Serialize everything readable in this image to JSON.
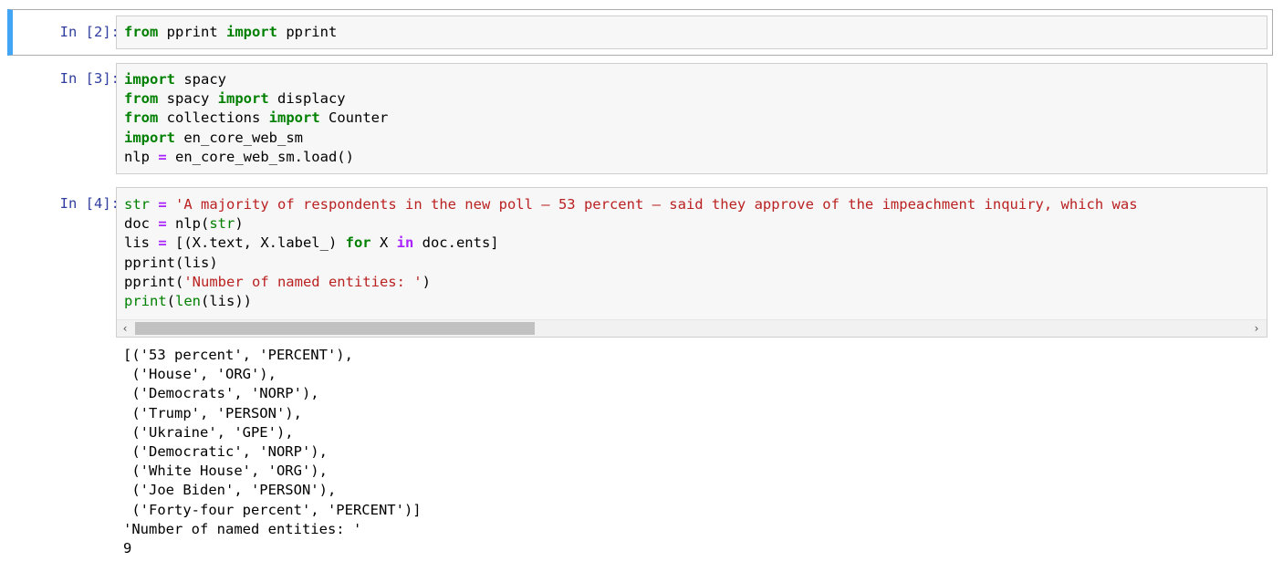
{
  "cells": [
    {
      "prompt": "In [2]:",
      "lines": [
        [
          {
            "t": "from",
            "c": "kw"
          },
          {
            "t": " pprint "
          },
          {
            "t": "import",
            "c": "kw"
          },
          {
            "t": " pprint"
          }
        ]
      ]
    },
    {
      "prompt": "In [3]:",
      "lines": [
        [
          {
            "t": "import",
            "c": "kw"
          },
          {
            "t": " spacy"
          }
        ],
        [
          {
            "t": "from",
            "c": "kw"
          },
          {
            "t": " spacy "
          },
          {
            "t": "import",
            "c": "kw"
          },
          {
            "t": " displacy"
          }
        ],
        [
          {
            "t": "from",
            "c": "kw"
          },
          {
            "t": " collections "
          },
          {
            "t": "import",
            "c": "kw"
          },
          {
            "t": " Counter"
          }
        ],
        [
          {
            "t": "import",
            "c": "kw"
          },
          {
            "t": " en_core_web_sm"
          }
        ],
        [
          {
            "t": "nlp "
          },
          {
            "t": "=",
            "c": "op"
          },
          {
            "t": " en_core_web_sm.load()"
          }
        ]
      ]
    },
    {
      "prompt": "In [4]:",
      "lines": [
        [
          {
            "t": "str",
            "c": "bi"
          },
          {
            "t": " "
          },
          {
            "t": "=",
            "c": "op"
          },
          {
            "t": " "
          },
          {
            "t": "'A majority of respondents in the new poll – 53 percent – said they approve of the impeachment inquiry, which was",
            "c": "str"
          }
        ],
        [
          {
            "t": "doc "
          },
          {
            "t": "=",
            "c": "op"
          },
          {
            "t": " nlp("
          },
          {
            "t": "str",
            "c": "bi"
          },
          {
            "t": ")"
          }
        ],
        [
          {
            "t": "lis "
          },
          {
            "t": "=",
            "c": "op"
          },
          {
            "t": " [(X.text, X.label_) "
          },
          {
            "t": "for",
            "c": "kw"
          },
          {
            "t": " X "
          },
          {
            "t": "in",
            "c": "op"
          },
          {
            "t": " doc.ents]"
          }
        ],
        [
          {
            "t": "pprint(lis)"
          }
        ],
        [
          {
            "t": "pprint("
          },
          {
            "t": "'Number of named entities: '",
            "c": "str"
          },
          {
            "t": ")"
          }
        ],
        [
          {
            "t": "print",
            "c": "bi"
          },
          {
            "t": "("
          },
          {
            "t": "len",
            "c": "bi"
          },
          {
            "t": "(lis))"
          }
        ]
      ],
      "output": [
        "[('53 percent', 'PERCENT'),",
        " ('House', 'ORG'),",
        " ('Democrats', 'NORP'),",
        " ('Trump', 'PERSON'),",
        " ('Ukraine', 'GPE'),",
        " ('Democratic', 'NORP'),",
        " ('White House', 'ORG'),",
        " ('Joe Biden', 'PERSON'),",
        " ('Forty-four percent', 'PERCENT')]",
        "'Number of named entities: '",
        "9"
      ]
    }
  ],
  "scrollbar": {
    "left_arrow": "‹",
    "right_arrow": "›"
  },
  "colors": {
    "keyword": "#008000",
    "operator": "#aa22ff",
    "string": "#ba2121",
    "prompt": "#303f9f",
    "selected_border": "#42a5f5"
  }
}
